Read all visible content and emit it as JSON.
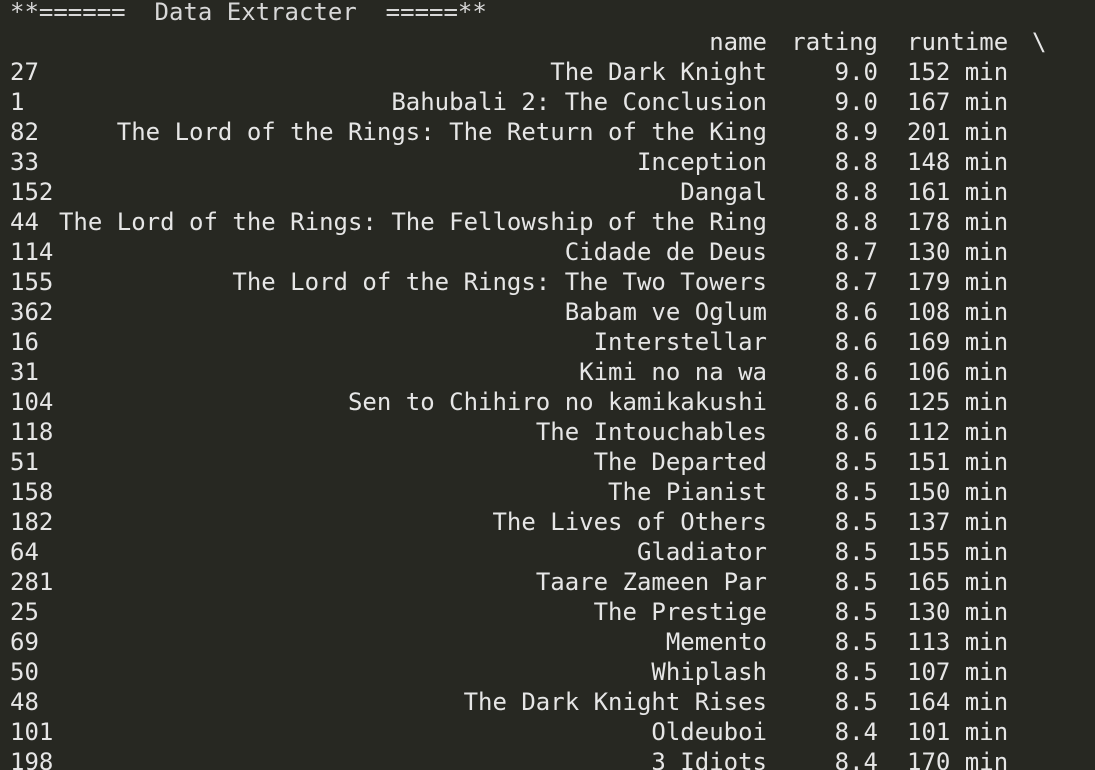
{
  "banner": "**======  Data Extracter  =====**",
  "header": {
    "name": "name",
    "rating": "rating",
    "runtime": "runtime",
    "continuation": "\\"
  },
  "rows": [
    {
      "index": "27",
      "name": "The Dark Knight",
      "rating": "9.0",
      "runtime": "152 min"
    },
    {
      "index": "1",
      "name": "Bahubali 2: The Conclusion",
      "rating": "9.0",
      "runtime": "167 min"
    },
    {
      "index": "82",
      "name": "The Lord of the Rings: The Return of the King",
      "rating": "8.9",
      "runtime": "201 min"
    },
    {
      "index": "33",
      "name": "Inception",
      "rating": "8.8",
      "runtime": "148 min"
    },
    {
      "index": "152",
      "name": "Dangal",
      "rating": "8.8",
      "runtime": "161 min"
    },
    {
      "index": "44",
      "name": "The Lord of the Rings: The Fellowship of the Ring",
      "rating": "8.8",
      "runtime": "178 min"
    },
    {
      "index": "114",
      "name": "Cidade de Deus",
      "rating": "8.7",
      "runtime": "130 min"
    },
    {
      "index": "155",
      "name": "The Lord of the Rings: The Two Towers",
      "rating": "8.7",
      "runtime": "179 min"
    },
    {
      "index": "362",
      "name": "Babam ve Oglum",
      "rating": "8.6",
      "runtime": "108 min"
    },
    {
      "index": "16",
      "name": "Interstellar",
      "rating": "8.6",
      "runtime": "169 min"
    },
    {
      "index": "31",
      "name": "Kimi no na wa",
      "rating": "8.6",
      "runtime": "106 min"
    },
    {
      "index": "104",
      "name": "Sen to Chihiro no kamikakushi",
      "rating": "8.6",
      "runtime": "125 min"
    },
    {
      "index": "118",
      "name": "The Intouchables",
      "rating": "8.6",
      "runtime": "112 min"
    },
    {
      "index": "51",
      "name": "The Departed",
      "rating": "8.5",
      "runtime": "151 min"
    },
    {
      "index": "158",
      "name": "The Pianist",
      "rating": "8.5",
      "runtime": "150 min"
    },
    {
      "index": "182",
      "name": "The Lives of Others",
      "rating": "8.5",
      "runtime": "137 min"
    },
    {
      "index": "64",
      "name": "Gladiator",
      "rating": "8.5",
      "runtime": "155 min"
    },
    {
      "index": "281",
      "name": "Taare Zameen Par",
      "rating": "8.5",
      "runtime": "165 min"
    },
    {
      "index": "25",
      "name": "The Prestige",
      "rating": "8.5",
      "runtime": "130 min"
    },
    {
      "index": "69",
      "name": "Memento",
      "rating": "8.5",
      "runtime": "113 min"
    },
    {
      "index": "50",
      "name": "Whiplash",
      "rating": "8.5",
      "runtime": "107 min"
    },
    {
      "index": "48",
      "name": "The Dark Knight Rises",
      "rating": "8.5",
      "runtime": "164 min"
    },
    {
      "index": "101",
      "name": "Oldeuboi",
      "rating": "8.4",
      "runtime": "101 min"
    },
    {
      "index": "198",
      "name": "3 Idiots",
      "rating": "8.4",
      "runtime": "170 min"
    }
  ],
  "colors": {
    "background": "#272822",
    "text": "#e6e6e6"
  }
}
